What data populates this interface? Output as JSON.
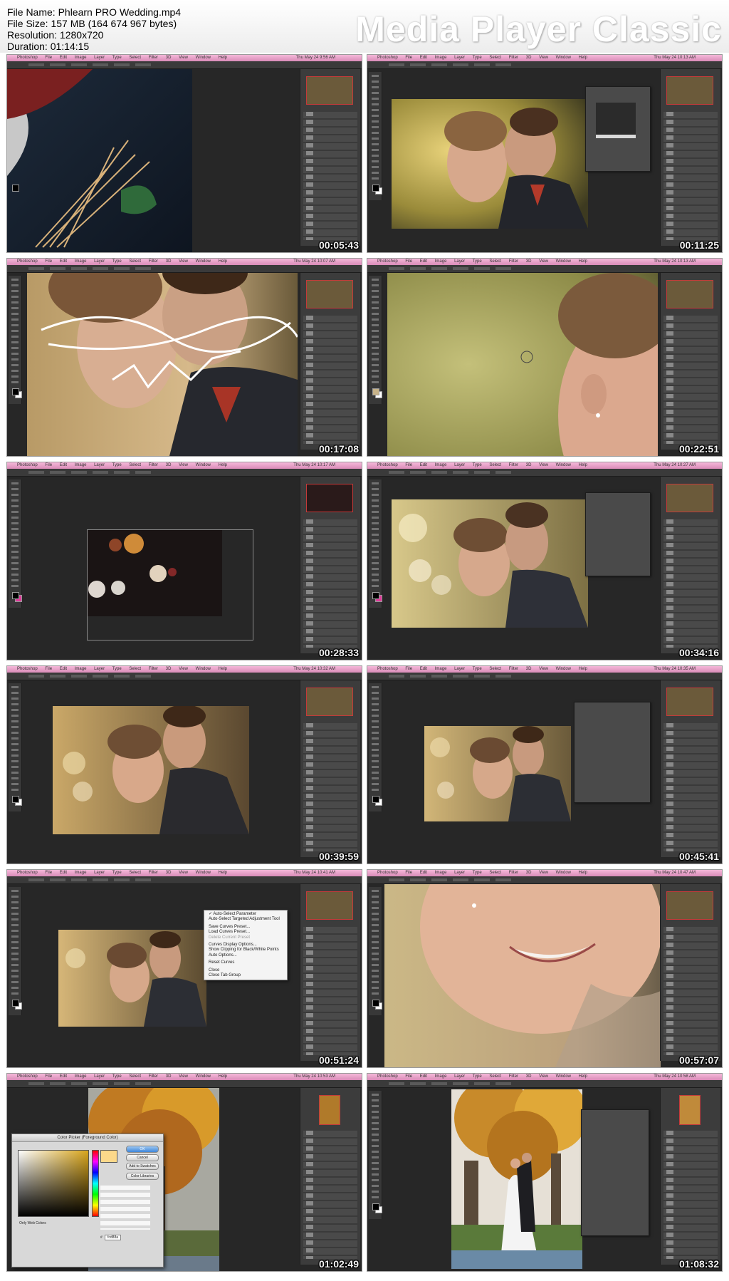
{
  "file_info": {
    "file_name": "File Name: Phlearn PRO Wedding.mp4",
    "file_size": "File Size: 157 MB (164 674 967 bytes)",
    "resolution": "Resolution: 1280x720",
    "duration": "Duration: 01:14:15"
  },
  "app_logo": "Media Player Classic",
  "menu": {
    "app": "Photoshop",
    "items": [
      "File",
      "Edit",
      "Image",
      "Layer",
      "Type",
      "Select",
      "Filter",
      "3D",
      "View",
      "Window",
      "Help"
    ]
  },
  "thumbnails": [
    {
      "timestamp": "00:05:43",
      "clock": "Thu May 24  9:56 AM"
    },
    {
      "timestamp": "00:11:25",
      "clock": "Thu May 24  10:13 AM"
    },
    {
      "timestamp": "00:17:08",
      "clock": "Thu May 24  10:07 AM"
    },
    {
      "timestamp": "00:22:51",
      "clock": "Thu May 24  10:13 AM"
    },
    {
      "timestamp": "00:28:33",
      "clock": "Thu May 24  10:17 AM"
    },
    {
      "timestamp": "00:34:16",
      "clock": "Thu May 24  10:27 AM"
    },
    {
      "timestamp": "00:39:59",
      "clock": "Thu May 24  10:32 AM"
    },
    {
      "timestamp": "00:45:41",
      "clock": "Thu May 24  10:35 AM"
    },
    {
      "timestamp": "00:51:24",
      "clock": "Thu May 24  10:41 AM"
    },
    {
      "timestamp": "00:57:07",
      "clock": "Thu May 24  10:47 AM"
    },
    {
      "timestamp": "01:02:49",
      "clock": "Thu May 24  10:53 AM"
    },
    {
      "timestamp": "01:08:32",
      "clock": "Thu May 24  10:58 AM"
    }
  ],
  "context_menu": {
    "items": [
      "✓ Auto-Select Parameter",
      "Auto-Select Targeted Adjustment Tool",
      "",
      "Save Curves Preset...",
      "Load Curves Preset...",
      "Delete Current Preset",
      "",
      "Curves Display Options...",
      "Show Clipping for Black/White Points",
      "Auto Options...",
      "",
      "Reset Curves",
      "",
      "Close",
      "Close Tab Group"
    ]
  },
  "color_picker": {
    "title": "Color Picker (Foreground Color)",
    "buttons": [
      "OK",
      "Cancel",
      "Add to Swatches",
      "Color Libraries"
    ],
    "only_web_colors": "Only Web Colors",
    "hex_label": "#",
    "hex_value": "fcd88a",
    "swatch_color": "#fcd88a"
  },
  "colors": {
    "menubar_pink": "#e39cc6",
    "panel_dark": "#3c3c3c",
    "canvas_bg": "#272727"
  }
}
